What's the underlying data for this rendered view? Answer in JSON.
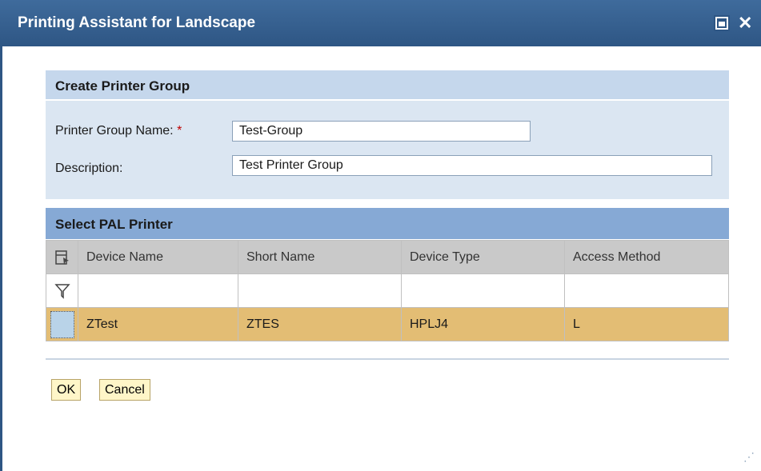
{
  "window": {
    "title": "Printing Assistant for Landscape",
    "close_glyph": "✕"
  },
  "form": {
    "header": "Create Printer Group",
    "group_name_label": "Printer Group Name:",
    "required_marker": "*",
    "group_name_value": "Test-Group",
    "description_label": "Description:",
    "description_value": "Test Printer Group"
  },
  "printer_table": {
    "header": "Select PAL Printer",
    "columns": [
      "Device Name",
      "Short Name",
      "Device Type",
      "Access Method"
    ],
    "rows": [
      {
        "device_name": "ZTest",
        "short_name": "ZTES",
        "device_type": "HPLJ4",
        "access_method": "L"
      }
    ]
  },
  "buttons": {
    "ok": "OK",
    "cancel": "Cancel"
  },
  "icons": {
    "column_settings": "column-settings-icon",
    "filter": "filter-icon"
  },
  "colors": {
    "title_bar": "#2e5684",
    "selected_row": "#e3bd74",
    "section_header": "#86a9d5"
  }
}
